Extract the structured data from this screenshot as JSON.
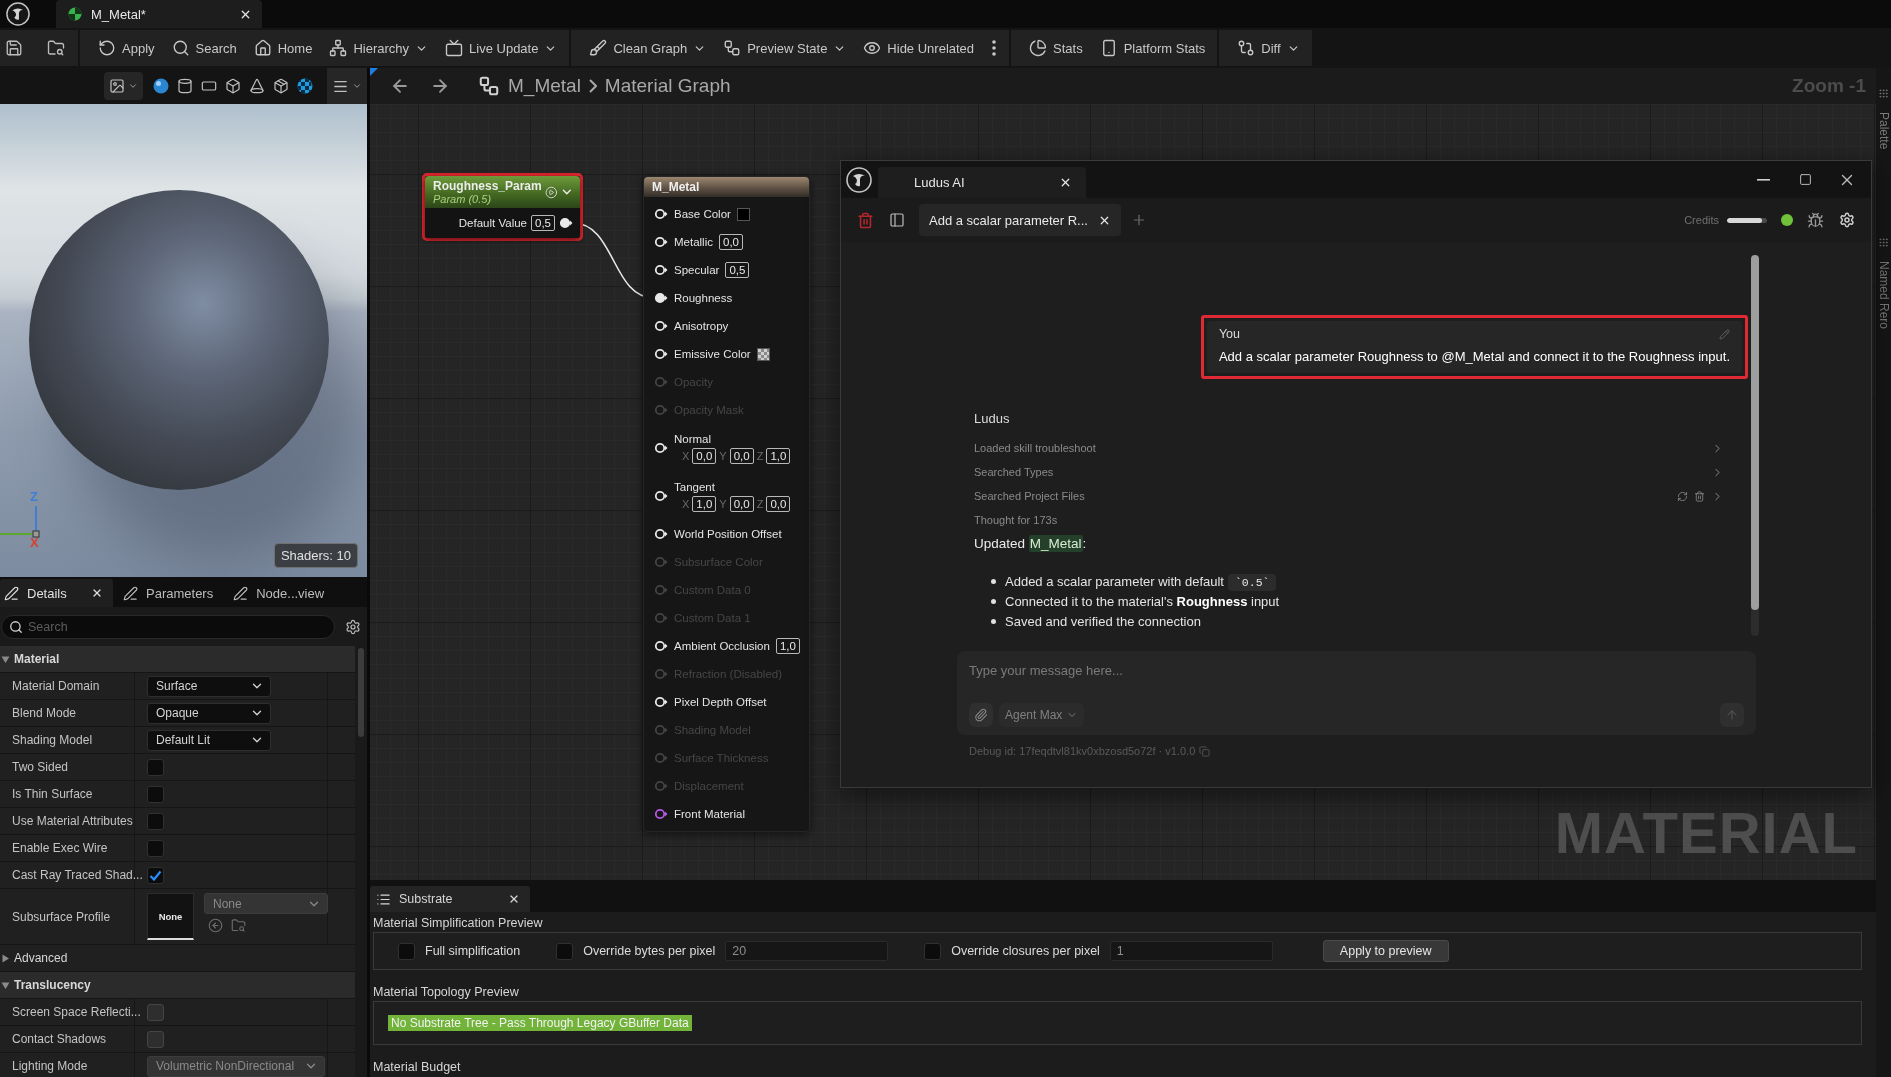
{
  "app_tabs": [
    {
      "label": "M_Metal*",
      "selected": true
    }
  ],
  "toolbar": {
    "groups": [
      {
        "items": [
          {
            "kind": "icon"
          },
          {
            "kind": "icon"
          }
        ]
      },
      {
        "items": [
          {
            "kind": "button",
            "label": "Apply",
            "dropdown": false
          },
          {
            "kind": "button",
            "label": "Search",
            "dropdown": false
          },
          {
            "kind": "button",
            "label": "Home",
            "dropdown": false
          },
          {
            "kind": "button",
            "label": "Hierarchy",
            "dropdown": true
          },
          {
            "kind": "button",
            "label": "Live Update",
            "dropdown": true
          }
        ]
      },
      {
        "items": [
          {
            "kind": "button",
            "label": "Clean Graph",
            "dropdown": true
          },
          {
            "kind": "button",
            "label": "Preview State",
            "dropdown": true
          },
          {
            "kind": "button",
            "label": "Hide Unrelated",
            "dropdown": false
          },
          {
            "kind": "overflow"
          }
        ]
      },
      {
        "items": [
          {
            "kind": "button",
            "label": "Stats",
            "dropdown": false
          },
          {
            "kind": "button",
            "label": "Platform Stats",
            "dropdown": false
          }
        ]
      },
      {
        "items": [
          {
            "kind": "button",
            "label": "Diff",
            "dropdown": true
          }
        ]
      }
    ]
  },
  "viewport": {
    "shaders": "Shaders: 10",
    "axis_labels": [
      {
        "label": "Z",
        "color": "#3d7fd6"
      },
      {
        "label": "X",
        "color": "#d9402f"
      }
    ]
  },
  "details": {
    "tabs": [
      {
        "label": "Details",
        "selected": true
      },
      {
        "label": "Parameters",
        "selected": false
      },
      {
        "label": "Node...view",
        "selected": false
      }
    ],
    "search": {
      "placeholder": "Search"
    },
    "sections": [
      {
        "kind": "header",
        "title": "Material",
        "expanded": true,
        "rows": [
          {
            "kind": "dropdown",
            "label": "Material Domain",
            "value": "Surface",
            "disabled": false
          },
          {
            "kind": "dropdown",
            "label": "Blend Mode",
            "value": "Opaque",
            "disabled": false
          },
          {
            "kind": "dropdown",
            "label": "Shading Model",
            "value": "Default Lit",
            "disabled": false
          },
          {
            "kind": "checkbox",
            "label": "Two Sided",
            "checked": false,
            "disabled": false
          },
          {
            "kind": "checkbox",
            "label": "Is Thin Surface",
            "checked": false,
            "disabled": false
          },
          {
            "kind": "checkbox",
            "label": "Use Material Attributes",
            "checked": false,
            "disabled": false
          },
          {
            "kind": "checkbox",
            "label": "Enable Exec Wire",
            "checked": false,
            "disabled": false
          },
          {
            "kind": "checkbox",
            "label": "Cast Ray Traced Shad...",
            "checked": true,
            "disabled": false
          },
          {
            "kind": "asset",
            "label": "Subsurface Profile",
            "thumbnail": "None",
            "value": "None",
            "disabled": true
          }
        ]
      },
      {
        "kind": "group",
        "title": "Advanced",
        "expanded": false
      },
      {
        "kind": "header",
        "title": "Translucency",
        "expanded": true,
        "rows": [
          {
            "kind": "checkbox",
            "label": "Screen Space Reflecti...",
            "checked": false,
            "disabled": true
          },
          {
            "kind": "checkbox",
            "label": "Contact Shadows",
            "checked": false,
            "disabled": true
          },
          {
            "kind": "dropdown",
            "label": "Lighting Mode",
            "value": "Volumetric NonDirectional",
            "disabled": true
          }
        ]
      }
    ]
  },
  "graph": {
    "breadcrumb": [
      "M_Metal",
      "Material Graph"
    ],
    "zoom": "Zoom -1",
    "corner_label": "MATERIAL",
    "nodes": [
      {
        "kind": "parameter",
        "title": "Roughness_Param",
        "subtitle": "Param (0.5)",
        "highlighted": true,
        "outputs": [
          {
            "label": "Default Value",
            "value": "0,5",
            "connected": true
          }
        ]
      },
      {
        "kind": "result",
        "title": "M_Metal",
        "highlighted": false,
        "inputs": [
          {
            "kind": "swatch",
            "label": "Base Color",
            "checker": false,
            "enabled": true,
            "connected": false
          },
          {
            "kind": "scalar",
            "label": "Metallic",
            "value": "0,0",
            "enabled": true,
            "connected": false
          },
          {
            "kind": "scalar",
            "label": "Specular",
            "value": "0,5",
            "enabled": true,
            "connected": false
          },
          {
            "kind": "plain",
            "label": "Roughness",
            "enabled": true,
            "connected": true
          },
          {
            "kind": "plain",
            "label": "Anisotropy",
            "enabled": true,
            "connected": false
          },
          {
            "kind": "swatch",
            "label": "Emissive Color",
            "checker": true,
            "enabled": true,
            "connected": false
          },
          {
            "kind": "plain",
            "label": "Opacity",
            "enabled": false,
            "connected": false
          },
          {
            "kind": "plain",
            "label": "Opacity Mask",
            "enabled": false,
            "connected": false
          },
          {
            "kind": "vector",
            "label": "Normal",
            "enabled": true,
            "connected": false,
            "components": [
              {
                "axis": "X",
                "value": "0,0"
              },
              {
                "axis": "Y",
                "value": "0,0"
              },
              {
                "axis": "Z",
                "value": "1,0"
              }
            ]
          },
          {
            "kind": "vector",
            "label": "Tangent",
            "enabled": true,
            "connected": false,
            "components": [
              {
                "axis": "X",
                "value": "1,0"
              },
              {
                "axis": "Y",
                "value": "0,0"
              },
              {
                "axis": "Z",
                "value": "0,0"
              }
            ]
          },
          {
            "kind": "plain",
            "label": "World Position Offset",
            "enabled": true,
            "connected": false
          },
          {
            "kind": "plain",
            "label": "Subsurface Color",
            "enabled": false,
            "connected": false
          },
          {
            "kind": "plain",
            "label": "Custom Data 0",
            "enabled": false,
            "connected": false
          },
          {
            "kind": "plain",
            "label": "Custom Data 1",
            "enabled": false,
            "connected": false
          },
          {
            "kind": "scalar",
            "label": "Ambient Occlusion",
            "value": "1,0",
            "enabled": true,
            "connected": false
          },
          {
            "kind": "plain",
            "label": "Refraction (Disabled)",
            "enabled": false,
            "connected": false
          },
          {
            "kind": "plain",
            "label": "Pixel Depth Offset",
            "enabled": true,
            "connected": false
          },
          {
            "kind": "plain",
            "label": "Shading Model",
            "enabled": false,
            "connected": false
          },
          {
            "kind": "plain",
            "label": "Surface Thickness",
            "enabled": false,
            "connected": false
          },
          {
            "kind": "plain",
            "label": "Displacement",
            "enabled": false,
            "connected": false
          },
          {
            "kind": "material",
            "label": "Front Material",
            "enabled": true,
            "connected": false
          }
        ]
      }
    ]
  },
  "ludus": {
    "title": "Ludus AI",
    "chat_tabs": [
      {
        "label": "Add a scalar parameter R...",
        "selected": true
      }
    ],
    "credits": {
      "label": "Credits",
      "level": 0.88
    },
    "messages": [
      {
        "kind": "user",
        "author": "You",
        "text": "Add a scalar parameter Roughness to @M_Metal and connect it to the Roughness input.",
        "highlighted": true
      },
      {
        "kind": "assistant",
        "author": "Ludus",
        "steps": [
          {
            "label": "Loaded skill troubleshoot",
            "expandable": true,
            "actions": false
          },
          {
            "label": "Searched Types",
            "expandable": true,
            "actions": false
          },
          {
            "label": "Searched Project Files",
            "expandable": true,
            "actions": true
          },
          {
            "label": "Thought for 173s",
            "expandable": false,
            "actions": false
          }
        ],
        "summary": {
          "text": "Updated",
          "link": "M_Metal",
          "suffix": ":"
        },
        "bullets": [
          {
            "text": "Added a scalar parameter with default",
            "code": "`0.5`"
          },
          {
            "text": "Connected it to the material's **Roughness** input"
          },
          {
            "text": "Saved and verified the connection"
          }
        ]
      }
    ],
    "composer": {
      "placeholder": "Type your message here...",
      "agent": "Agent Max"
    },
    "debug": "Debug id: 17feqdtvl81kv0xbzosd5o72f · v1.0.0"
  },
  "substrate": {
    "tab": "Substrate",
    "simplification": {
      "title": "Material Simplification Preview",
      "options": [
        {
          "kind": "check",
          "label": "Full simplification",
          "checked": false
        },
        {
          "kind": "check_field",
          "label": "Override bytes per pixel",
          "checked": false,
          "value": "20"
        },
        {
          "kind": "check_field",
          "label": "Override closures per pixel",
          "checked": false,
          "value": "1"
        }
      ],
      "button": "Apply to preview"
    },
    "topology": {
      "title": "Material Topology Preview",
      "tree": "No Substrate Tree - Pass Through Legacy GBuffer Data"
    },
    "budget": {
      "title": "Material Budget"
    }
  },
  "side_tabs": [
    {
      "label": "Palette"
    },
    {
      "label": "Named Rero"
    }
  ]
}
